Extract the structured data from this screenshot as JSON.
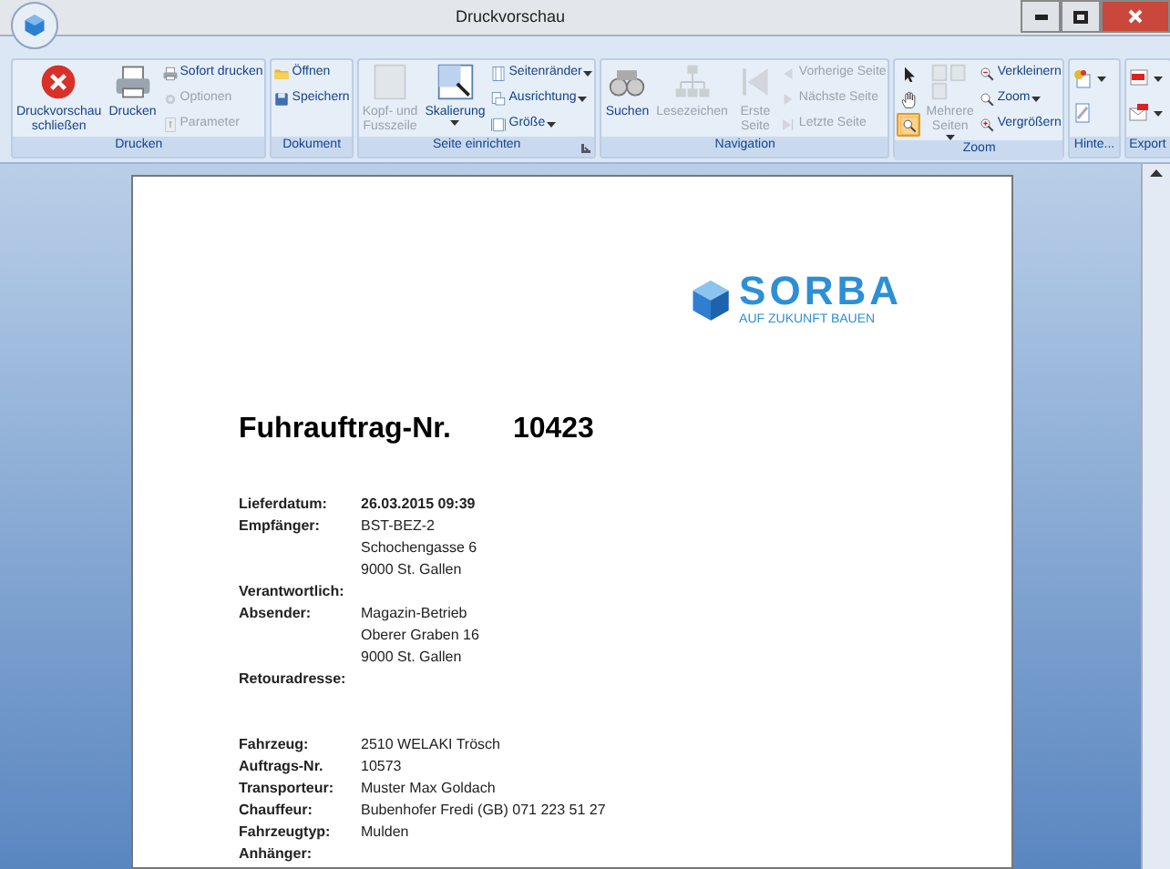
{
  "window": {
    "title": "Druckvorschau"
  },
  "ribbon": {
    "groups": [
      {
        "label": "Drucken",
        "launcher": false,
        "columns": [
          [
            {
              "kind": "large",
              "label": "Druckvorschau\nschließen",
              "disabled": false,
              "dropdown": false
            }
          ],
          [
            {
              "kind": "large",
              "label": "Drucken",
              "disabled": false,
              "dropdown": false
            }
          ],
          [
            {
              "kind": "small",
              "label": "Sofort drucken",
              "disabled": false,
              "dropdown": false
            },
            {
              "kind": "small",
              "label": "Optionen",
              "disabled": true,
              "dropdown": false
            },
            {
              "kind": "small",
              "label": "Parameter",
              "disabled": true,
              "dropdown": false
            }
          ]
        ]
      },
      {
        "label": "Dokument",
        "launcher": false,
        "columns": [
          [
            {
              "kind": "small",
              "label": "Öffnen",
              "disabled": false,
              "dropdown": false
            },
            {
              "kind": "small",
              "label": "Speichern",
              "disabled": false,
              "dropdown": false
            }
          ]
        ]
      },
      {
        "label": "Seite einrichten",
        "launcher": true,
        "columns": [
          [
            {
              "kind": "large",
              "label": "Kopf- und\nFusszeile",
              "disabled": true,
              "dropdown": false
            }
          ],
          [
            {
              "kind": "large",
              "label": "Skalierung",
              "disabled": false,
              "dropdown": true
            }
          ],
          [
            {
              "kind": "small",
              "label": "Seitenränder",
              "disabled": false,
              "dropdown": true
            },
            {
              "kind": "small",
              "label": "Ausrichtung",
              "disabled": false,
              "dropdown": true
            },
            {
              "kind": "small",
              "label": "Größe",
              "disabled": false,
              "dropdown": true
            }
          ]
        ]
      },
      {
        "label": "Navigation",
        "launcher": false,
        "columns": [
          [
            {
              "kind": "large",
              "label": "Suchen",
              "disabled": false,
              "dropdown": false
            }
          ],
          [
            {
              "kind": "large",
              "label": "Lesezeichen",
              "disabled": true,
              "dropdown": false
            }
          ],
          [
            {
              "kind": "large",
              "label": "Erste\nSeite",
              "disabled": true,
              "dropdown": false
            }
          ],
          [
            {
              "kind": "small",
              "label": "Vorherige Seite",
              "disabled": true,
              "dropdown": false
            },
            {
              "kind": "small",
              "label": "Nächste Seite",
              "disabled": true,
              "dropdown": false
            },
            {
              "kind": "small",
              "label": "Letzte Seite",
              "disabled": true,
              "dropdown": false
            }
          ]
        ]
      },
      {
        "label": "Zoom",
        "launcher": false,
        "columns": [
          [
            {
              "kind": "tool",
              "selected": false
            },
            {
              "kind": "tool",
              "selected": false
            },
            {
              "kind": "tool",
              "selected": true
            }
          ],
          [
            {
              "kind": "large",
              "label": "Mehrere\nSeiten",
              "disabled": true,
              "dropdown": true
            }
          ],
          [
            {
              "kind": "small",
              "label": "Verkleinern",
              "disabled": false,
              "dropdown": false
            },
            {
              "kind": "small",
              "label": "Zoom",
              "disabled": false,
              "dropdown": true
            },
            {
              "kind": "small",
              "label": "Vergrößern",
              "disabled": false,
              "dropdown": false
            }
          ]
        ]
      },
      {
        "label": "Hinte...",
        "launcher": false,
        "columns": [
          [
            {
              "kind": "icon",
              "dropdown": true
            },
            {
              "kind": "icon",
              "dropdown": false
            }
          ]
        ]
      },
      {
        "label": "Export",
        "launcher": false,
        "columns": [
          [
            {
              "kind": "icon",
              "dropdown": true
            },
            {
              "kind": "icon",
              "dropdown": true
            }
          ]
        ]
      }
    ]
  },
  "document": {
    "logo": {
      "name": "SORBA",
      "slogan": "AUF ZUKUNFT BAUEN"
    },
    "title": "Fuhrauftrag-Nr.",
    "number": "10423",
    "sections": [
      [
        {
          "label": "Lieferdatum:",
          "lines": [
            "26.03.2015 09:39"
          ],
          "bold": true
        },
        {
          "label": "Empfänger:",
          "lines": [
            "BST-BEZ-2",
            "Schochengasse 6",
            "9000 St. Gallen"
          ],
          "bold": false
        },
        {
          "label": "Verantwortlich:"
        },
        {
          "label": "Absender:",
          "lines": [
            "Magazin-Betrieb",
            "Oberer Graben 16",
            "9000 St. Gallen"
          ],
          "bold": false
        },
        {
          "label": "Retouradresse:"
        }
      ],
      [
        {
          "label": "Fahrzeug:",
          "lines": [
            "2510 WELAKI Trösch"
          ],
          "bold": false
        },
        {
          "label": "Auftrags-Nr.",
          "lines": [
            "10573"
          ],
          "bold": false
        },
        {
          "label": "Transporteur:",
          "lines": [
            "Muster Max Goldach"
          ],
          "bold": false
        },
        {
          "label": "Chauffeur:",
          "lines": [
            "Bubenhofer Fredi (GB) 071 223 51 27"
          ],
          "bold": false
        },
        {
          "label": "Fahrzeugtyp:",
          "lines": [
            "Mulden"
          ],
          "bold": false
        },
        {
          "label": "Anhänger:"
        }
      ]
    ]
  }
}
